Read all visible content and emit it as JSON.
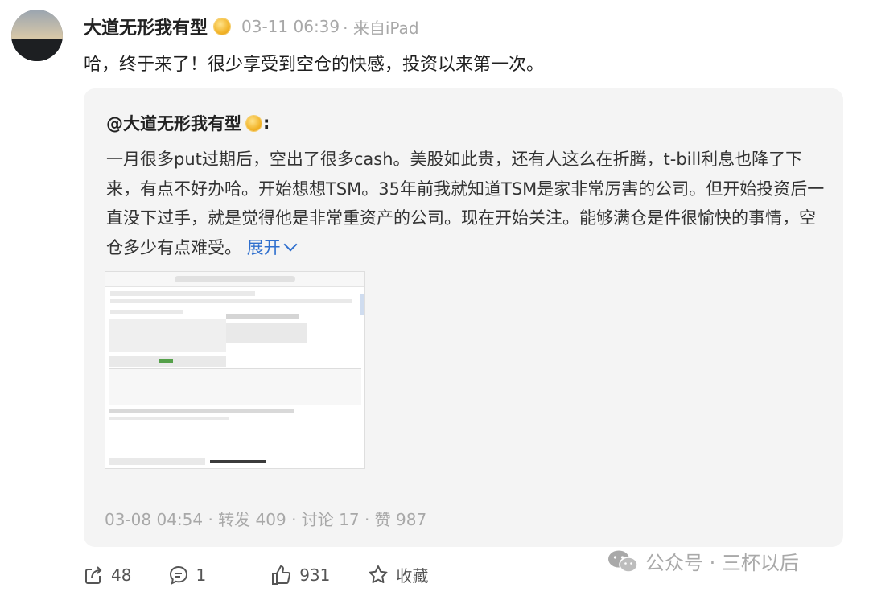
{
  "post": {
    "username": "大道无形我有型",
    "timestamp": "03-11 06:39",
    "source": "· 来自iPad",
    "text": "哈，终于来了！很少享受到空仓的快感，投资以来第一次。"
  },
  "quoted": {
    "author": "@大道无形我有型",
    "colon": ":",
    "text": "一月很多put过期后，空出了很多cash。美股如此贵，还有人这么在折腾，t-bill利息也降了下来，有点不好办哈。开始想想TSM。35年前我就知道TSM是家非常厉害的公司。但开始投资后一直没下过手，就是觉得他是非常重资产的公司。现在开始关注。能够满仓是件很愉快的事情，空仓多少有点难受。",
    "expand_label": "展开",
    "meta": "03-08 04:54 · 转发 409 · 讨论 17 · 赞 987"
  },
  "footer": {
    "share_count": "48",
    "comment_count": "1",
    "like_count": "931",
    "favorite_label": "收藏"
  },
  "watermark": {
    "text": "公众号 · 三杯以后"
  },
  "colors": {
    "link": "#2f6fce",
    "muted": "#a8a8a8",
    "quote_bg": "#f4f4f4"
  }
}
